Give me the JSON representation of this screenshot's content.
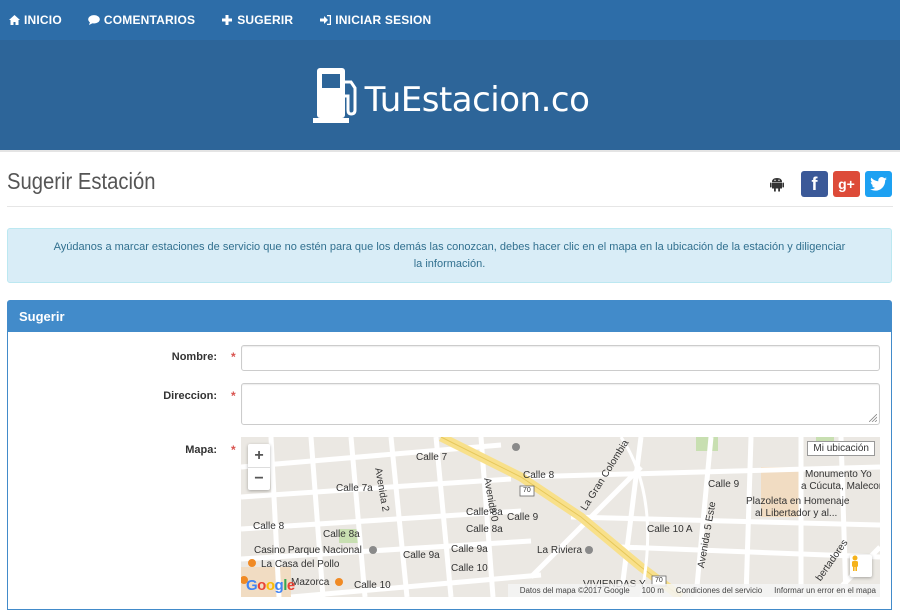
{
  "nav": {
    "items": [
      {
        "label": "INICIO",
        "icon": "home-icon"
      },
      {
        "label": "COMENTARIOS",
        "icon": "comment-icon"
      },
      {
        "label": "SUGERIR",
        "icon": "plus-icon"
      },
      {
        "label": "INICIAR SESION",
        "icon": "sign-in-icon"
      }
    ]
  },
  "brand": {
    "logo_text": "TuEstacion.co"
  },
  "page": {
    "title": "Sugerir Estación"
  },
  "social": {
    "android": "android-icon",
    "facebook": "f",
    "google": "g+",
    "twitter": "twitter-icon"
  },
  "alert": {
    "text": "Ayúdanos a marcar estaciones de servicio que no estén para que los demás las conozcan, debes hacer clic en el mapa en la ubicación de la estación y diligenciar la información."
  },
  "panel": {
    "heading": "Sugerir"
  },
  "form": {
    "name_label": "Nombre:",
    "address_label": "Direccion:",
    "map_label": "Mapa:",
    "required_mark": "*",
    "name_value": "",
    "address_value": ""
  },
  "map": {
    "zoom_in": "+",
    "zoom_out": "−",
    "my_location": "Mi ubicación",
    "labels": {
      "calle7": "Calle 7",
      "calle7a": "Calle 7a",
      "calle8": "Calle 8",
      "calle8_right": "Calle 8",
      "calle8a": "Calle 8a",
      "calle8a_mid": "Calle 8a",
      "calle8a_top": "Calle 8a",
      "calle9": "Calle 9",
      "calle9_right": "Calle 9",
      "calle9a": "Calle 9a",
      "calle9a_2": "Calle 9a",
      "calle10": "Calle 10",
      "calle10_2": "Calle 10",
      "calle10a": "Calle 10 A",
      "avenida2": "Avenida 2",
      "avenida0": "Avenida 0",
      "avenida5": "Avenida 5 Este",
      "gran_colombia": "La Gran Colombia",
      "casino": "Casino Parque Nacional",
      "casa_pollo": "La Casa del Pollo",
      "mazorca": "Mazorca",
      "riviera": "La Riviera",
      "viviendas": "VIVIENDAS Y",
      "monumento": "Monumento Yo",
      "cucuta": "a Cúcuta, Malecon",
      "plazoleta": "Plazoleta en Homenaje",
      "libertador": "al Libertador y al...",
      "libertadores": "bertadores",
      "route70": "70"
    },
    "footer": {
      "data": "Datos del mapa ©2017 Google",
      "scale": "100 m",
      "terms": "Condiciones del servicio",
      "report": "Informar un error en el mapa"
    },
    "google": "Google"
  },
  "colors": {
    "nav_bg": "#2d6da8",
    "banner_bg": "#2d6599",
    "panel_primary": "#428bca",
    "facebook": "#3b5998",
    "google": "#dd4b39",
    "twitter": "#1da1f2",
    "alert_bg": "#d9edf7",
    "alert_text": "#31708f"
  }
}
